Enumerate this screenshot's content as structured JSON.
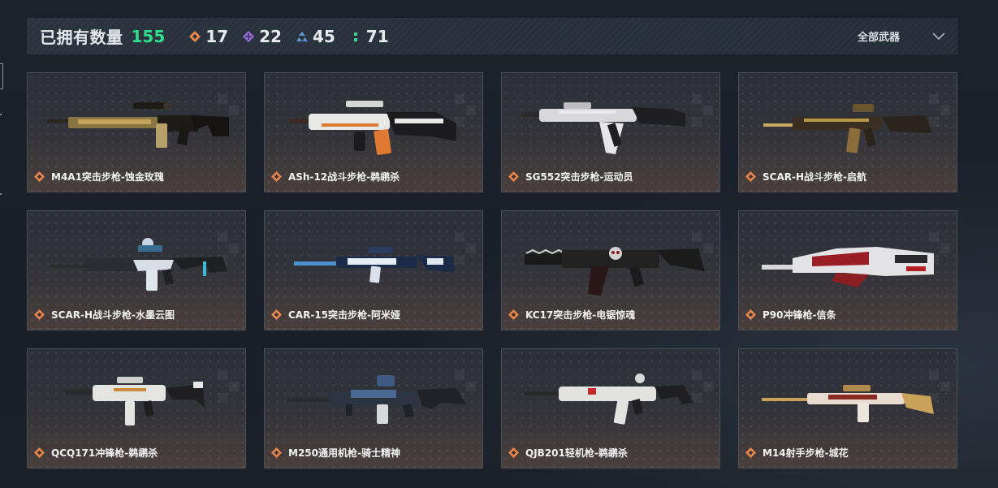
{
  "header": {
    "owned_label": "已拥有数量",
    "owned_count": "155",
    "stats": [
      {
        "icon": "orange-diamond-icon",
        "value": "17",
        "color": "#e8864a"
      },
      {
        "icon": "purple-diamond-icon",
        "value": "22",
        "color": "#9b6be0"
      },
      {
        "icon": "blue-triangle-icon",
        "value": "45",
        "color": "#5d95d6"
      },
      {
        "icon": "green-dots-icon",
        "value": "71",
        "color": "#3fcf8e"
      }
    ],
    "filter_label": "全部武器"
  },
  "weapons": [
    {
      "name": "M4A1突击步枪-蚀金玫瑰",
      "rarity_color": "#e8864a"
    },
    {
      "name": "ASh-12战斗步枪-鹈鹕杀",
      "rarity_color": "#e8864a"
    },
    {
      "name": "SG552突击步枪-运动员",
      "rarity_color": "#e8864a"
    },
    {
      "name": "SCAR-H战斗步枪-启航",
      "rarity_color": "#e8864a"
    },
    {
      "name": "SCAR-H战斗步枪-水墨云图",
      "rarity_color": "#e8864a"
    },
    {
      "name": "CAR-15突击步枪-阿米娅",
      "rarity_color": "#e8864a"
    },
    {
      "name": "KC17突击步枪-电锯惊魂",
      "rarity_color": "#e8864a"
    },
    {
      "name": "P90冲锋枪-信条",
      "rarity_color": "#e8864a"
    },
    {
      "name": "QCQ171冲锋枪-鹈鹕杀",
      "rarity_color": "#e8864a"
    },
    {
      "name": "M250通用机枪-骑士精神",
      "rarity_color": "#e8864a"
    },
    {
      "name": "QJB201轻机枪-鹈鹕杀",
      "rarity_color": "#e8864a"
    },
    {
      "name": "M14射手步枪-城花",
      "rarity_color": "#e8864a"
    }
  ]
}
